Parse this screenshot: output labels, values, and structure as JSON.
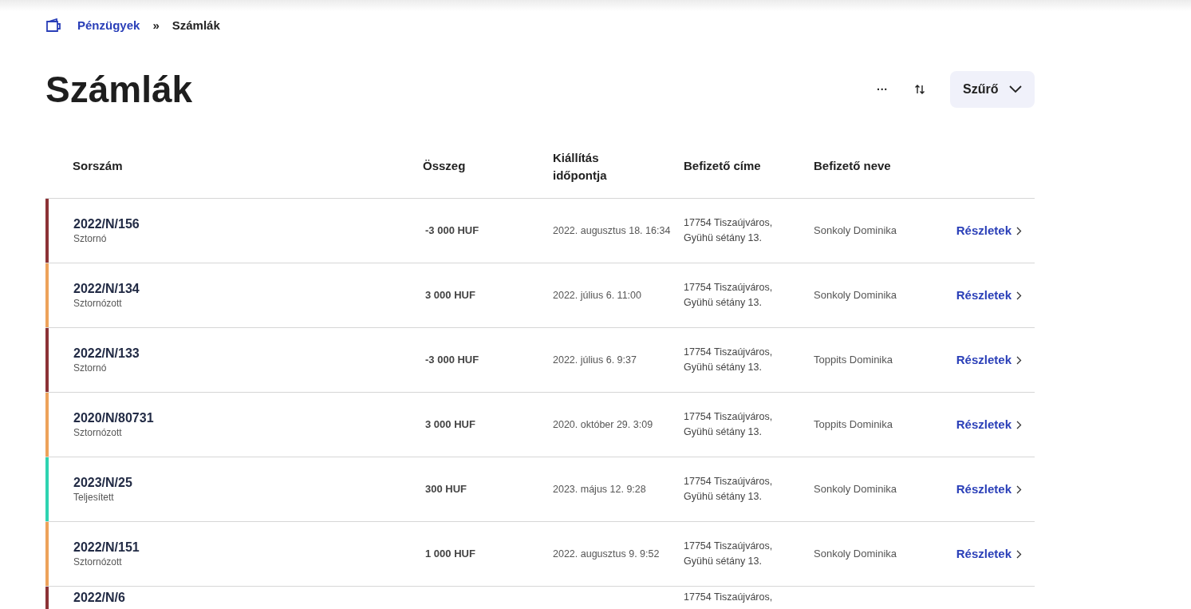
{
  "breadcrumb": {
    "parent": "Pénzügyek",
    "separator": "»",
    "current": "Számlák"
  },
  "title": "Számlák",
  "toolbar": {
    "more": "···",
    "filter": "Szűrő"
  },
  "table": {
    "columns": [
      "Sorszám",
      "Összeg",
      "Kiállítás időpontja",
      "Befizető címe",
      "Befizető neve"
    ],
    "rows": [
      {
        "number": "2022/N/156",
        "status": "Sztornó",
        "color": "#8c3236",
        "amount": "-3 000 HUF",
        "date": "2022. augusztus 18. 16:34",
        "address": "17754 Tiszaújváros, Gyühü sétány 13.",
        "payer": "Sonkoly Dominika",
        "link": "Részletek"
      },
      {
        "number": "2022/N/134",
        "status": "Sztornózott",
        "color": "#eda25a",
        "amount": "3 000 HUF",
        "date": "2022. július 6. 11:00",
        "address": "17754 Tiszaújváros, Gyühü sétány 13.",
        "payer": "Sonkoly Dominika",
        "link": "Részletek"
      },
      {
        "number": "2022/N/133",
        "status": "Sztornó",
        "color": "#8c3236",
        "amount": "-3 000 HUF",
        "date": "2022. július 6. 9:37",
        "address": "17754 Tiszaújváros, Gyühü sétány 13.",
        "payer": "Toppits Dominika",
        "link": "Részletek"
      },
      {
        "number": "2020/N/80731",
        "status": "Sztornózott",
        "color": "#eda25a",
        "amount": "3 000 HUF",
        "date": "2020. október 29. 3:09",
        "address": "17754 Tiszaújváros, Gyühü sétány 13.",
        "payer": "Toppits Dominika",
        "link": "Részletek"
      },
      {
        "number": "2023/N/25",
        "status": "Teljesített",
        "color": "#2ed3b0",
        "amount": "300 HUF",
        "date": "2023. május 12. 9:28",
        "address": "17754 Tiszaújváros, Gyühü sétány 13.",
        "payer": "Sonkoly Dominika",
        "link": "Részletek"
      },
      {
        "number": "2022/N/151",
        "status": "Sztornózott",
        "color": "#eda25a",
        "amount": "1 000 HUF",
        "date": "2022. augusztus 9. 9:52",
        "address": "17754 Tiszaújváros, Gyühü sétány 13.",
        "payer": "Sonkoly Dominika",
        "link": "Részletek"
      },
      {
        "number": "2022/N/6",
        "color": "#8c3236",
        "address": "17754 Tiszaújváros,"
      }
    ]
  }
}
